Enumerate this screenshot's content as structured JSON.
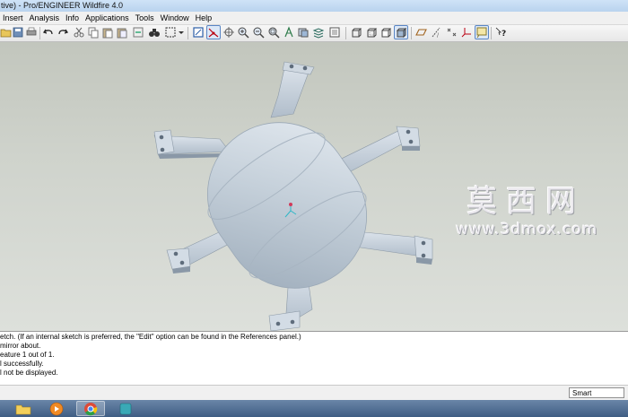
{
  "window": {
    "title": "tive) - Pro/ENGINEER Wildfire 4.0"
  },
  "menu": [
    "Insert",
    "Analysis",
    "Info",
    "Applications",
    "Tools",
    "Window",
    "Help"
  ],
  "watermark": {
    "chinese": "莫西网",
    "url": "www.3dmox.com"
  },
  "messages": [
    "etch. (If an internal sketch is preferred, the \"Edit\" option can be found in the References panel.)",
    "mirror about.",
    "eature 1 out of 1.",
    "l successfully.",
    "l not be displayed."
  ],
  "statusbar": {
    "filter_value": "Smart"
  },
  "colors": {
    "part": "#c4ced8",
    "viewport_top": "#c2c6bd",
    "taskbar": "#4a6790"
  },
  "taskbar": [
    "file-explorer-icon",
    "media-player-icon",
    "chrome-icon",
    "proe-icon"
  ]
}
